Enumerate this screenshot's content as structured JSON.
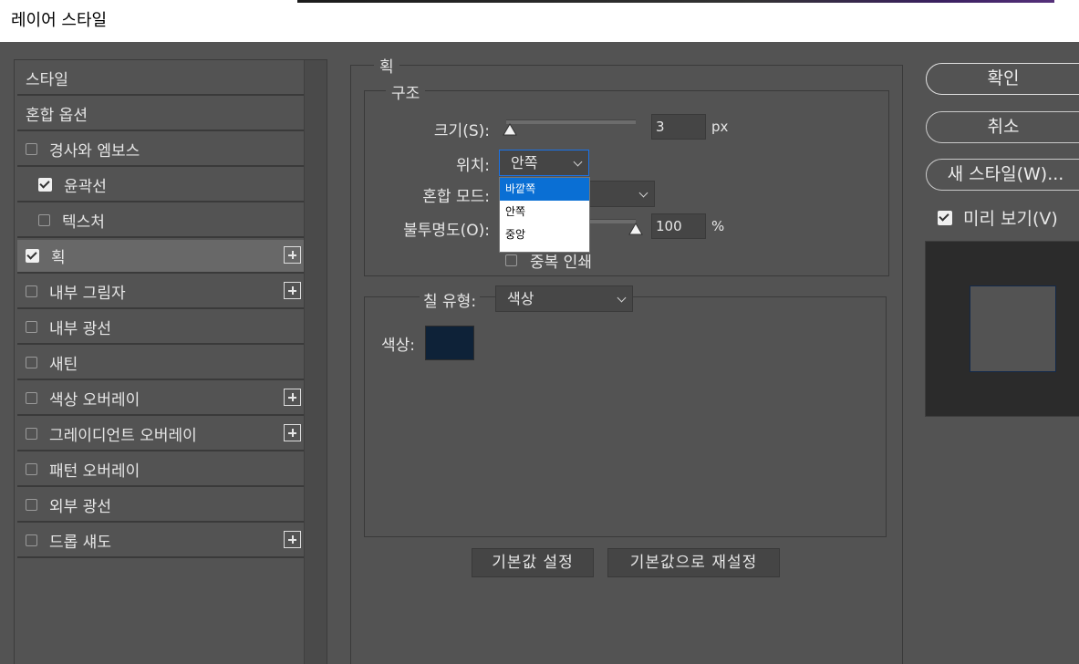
{
  "window": {
    "title": "레이어 스타일"
  },
  "style_list": [
    {
      "label": "스타일",
      "has_checkbox": false,
      "checked": false,
      "has_plus": false,
      "indent": false,
      "selected": false
    },
    {
      "label": "혼합 옵션",
      "has_checkbox": false,
      "checked": false,
      "has_plus": false,
      "indent": false,
      "selected": false
    },
    {
      "label": "경사와 엠보스",
      "has_checkbox": true,
      "checked": false,
      "has_plus": false,
      "indent": false,
      "selected": false
    },
    {
      "label": "윤곽선",
      "has_checkbox": true,
      "checked": true,
      "has_plus": false,
      "indent": true,
      "selected": false
    },
    {
      "label": "텍스처",
      "has_checkbox": true,
      "checked": false,
      "has_plus": false,
      "indent": true,
      "selected": false
    },
    {
      "label": "획",
      "has_checkbox": true,
      "checked": true,
      "has_plus": true,
      "indent": false,
      "selected": true
    },
    {
      "label": "내부 그림자",
      "has_checkbox": true,
      "checked": false,
      "has_plus": true,
      "indent": false,
      "selected": false
    },
    {
      "label": "내부 광선",
      "has_checkbox": true,
      "checked": false,
      "has_plus": false,
      "indent": false,
      "selected": false
    },
    {
      "label": "새틴",
      "has_checkbox": true,
      "checked": false,
      "has_plus": false,
      "indent": false,
      "selected": false
    },
    {
      "label": "색상 오버레이",
      "has_checkbox": true,
      "checked": false,
      "has_plus": true,
      "indent": false,
      "selected": false
    },
    {
      "label": "그레이디언트 오버레이",
      "has_checkbox": true,
      "checked": false,
      "has_plus": true,
      "indent": false,
      "selected": false
    },
    {
      "label": "패턴 오버레이",
      "has_checkbox": true,
      "checked": false,
      "has_plus": false,
      "indent": false,
      "selected": false
    },
    {
      "label": "외부 광선",
      "has_checkbox": true,
      "checked": false,
      "has_plus": false,
      "indent": false,
      "selected": false
    },
    {
      "label": "드롭 섀도",
      "has_checkbox": true,
      "checked": false,
      "has_plus": true,
      "indent": false,
      "selected": false
    }
  ],
  "stroke": {
    "section_title": "획",
    "structure": {
      "title": "구조",
      "size_label": "크기(S):",
      "size_value": "3",
      "size_unit": "px",
      "size_fraction": 0.03,
      "position_label": "위치:",
      "position_value": "안쪽",
      "blend_label": "혼합 모드:",
      "opacity_label": "불투명도(O):",
      "opacity_value": "100",
      "opacity_unit": "%",
      "opacity_fraction": 1.0,
      "overprint_label": "중복 인쇄"
    },
    "position_dropdown": {
      "options": [
        "바깥쪽",
        "안쪽",
        "중앙"
      ],
      "highlighted": "바깥쪽"
    },
    "fill": {
      "type_label": "칠 유형:",
      "type_value": "색상",
      "color_label": "색상:",
      "color_value": "#0e2238"
    },
    "buttons": {
      "set_default": "기본값 설정",
      "reset_default": "기본값으로 재설정"
    }
  },
  "actions": {
    "ok": "확인",
    "cancel": "취소",
    "new_style": "새 스타일(W)...",
    "preview_label": "미리 보기(V)",
    "preview_checked": true
  }
}
